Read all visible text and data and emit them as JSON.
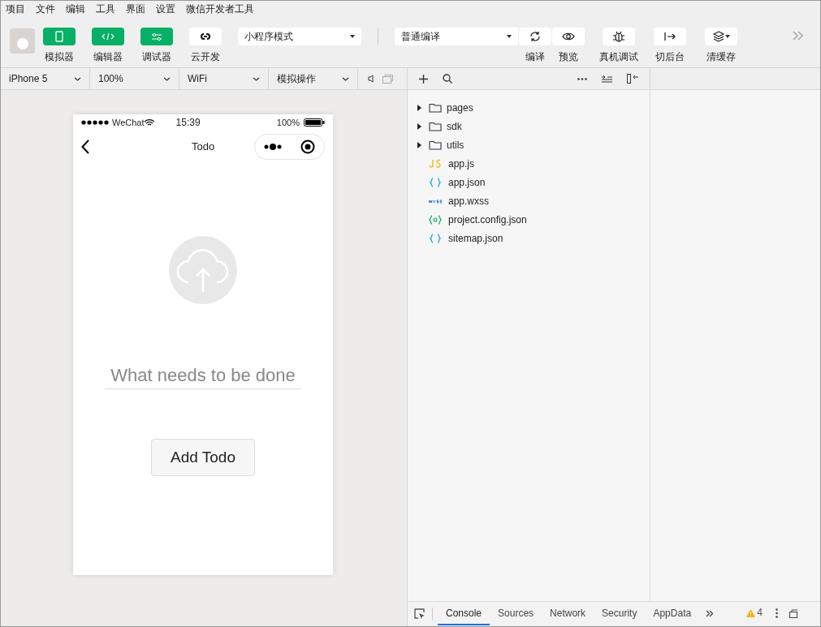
{
  "menu": [
    "项目",
    "文件",
    "编辑",
    "工具",
    "界面",
    "设置",
    "微信开发者工具"
  ],
  "mode_buttons": [
    {
      "label": "模拟器",
      "selected": true
    },
    {
      "label": "编辑器",
      "selected": true
    },
    {
      "label": "调试器",
      "selected": true
    },
    {
      "label": "云开发",
      "selected": false
    }
  ],
  "mode_select": {
    "value": "小程序模式"
  },
  "compile_select": {
    "value": "普通编译"
  },
  "actions": [
    "编译",
    "预览",
    "真机调试",
    "切后台",
    "清缓存"
  ],
  "sim_bar": [
    {
      "value": "iPhone 5"
    },
    {
      "value": "100%"
    },
    {
      "value": "WiFi"
    },
    {
      "value": "模拟操作"
    }
  ],
  "phone": {
    "carrier": "WeChat",
    "time": "15:39",
    "battery": "100%",
    "title": "Todo",
    "input_placeholder": "What needs to be done",
    "button": "Add Todo"
  },
  "files": [
    {
      "name": "pages",
      "kind": "folder"
    },
    {
      "name": "sdk",
      "kind": "folder"
    },
    {
      "name": "utils",
      "kind": "folder"
    },
    {
      "name": "app.js",
      "kind": "js"
    },
    {
      "name": "app.json",
      "kind": "json"
    },
    {
      "name": "app.wxss",
      "kind": "wxss"
    },
    {
      "name": "project.config.json",
      "kind": "config"
    },
    {
      "name": "sitemap.json",
      "kind": "json"
    }
  ],
  "devtools_tabs": [
    {
      "label": "Console",
      "selected": true
    },
    {
      "label": "Sources",
      "selected": false
    },
    {
      "label": "Network",
      "selected": false
    },
    {
      "label": "Security",
      "selected": false
    },
    {
      "label": "AppData",
      "selected": false
    }
  ],
  "warnings": "4"
}
